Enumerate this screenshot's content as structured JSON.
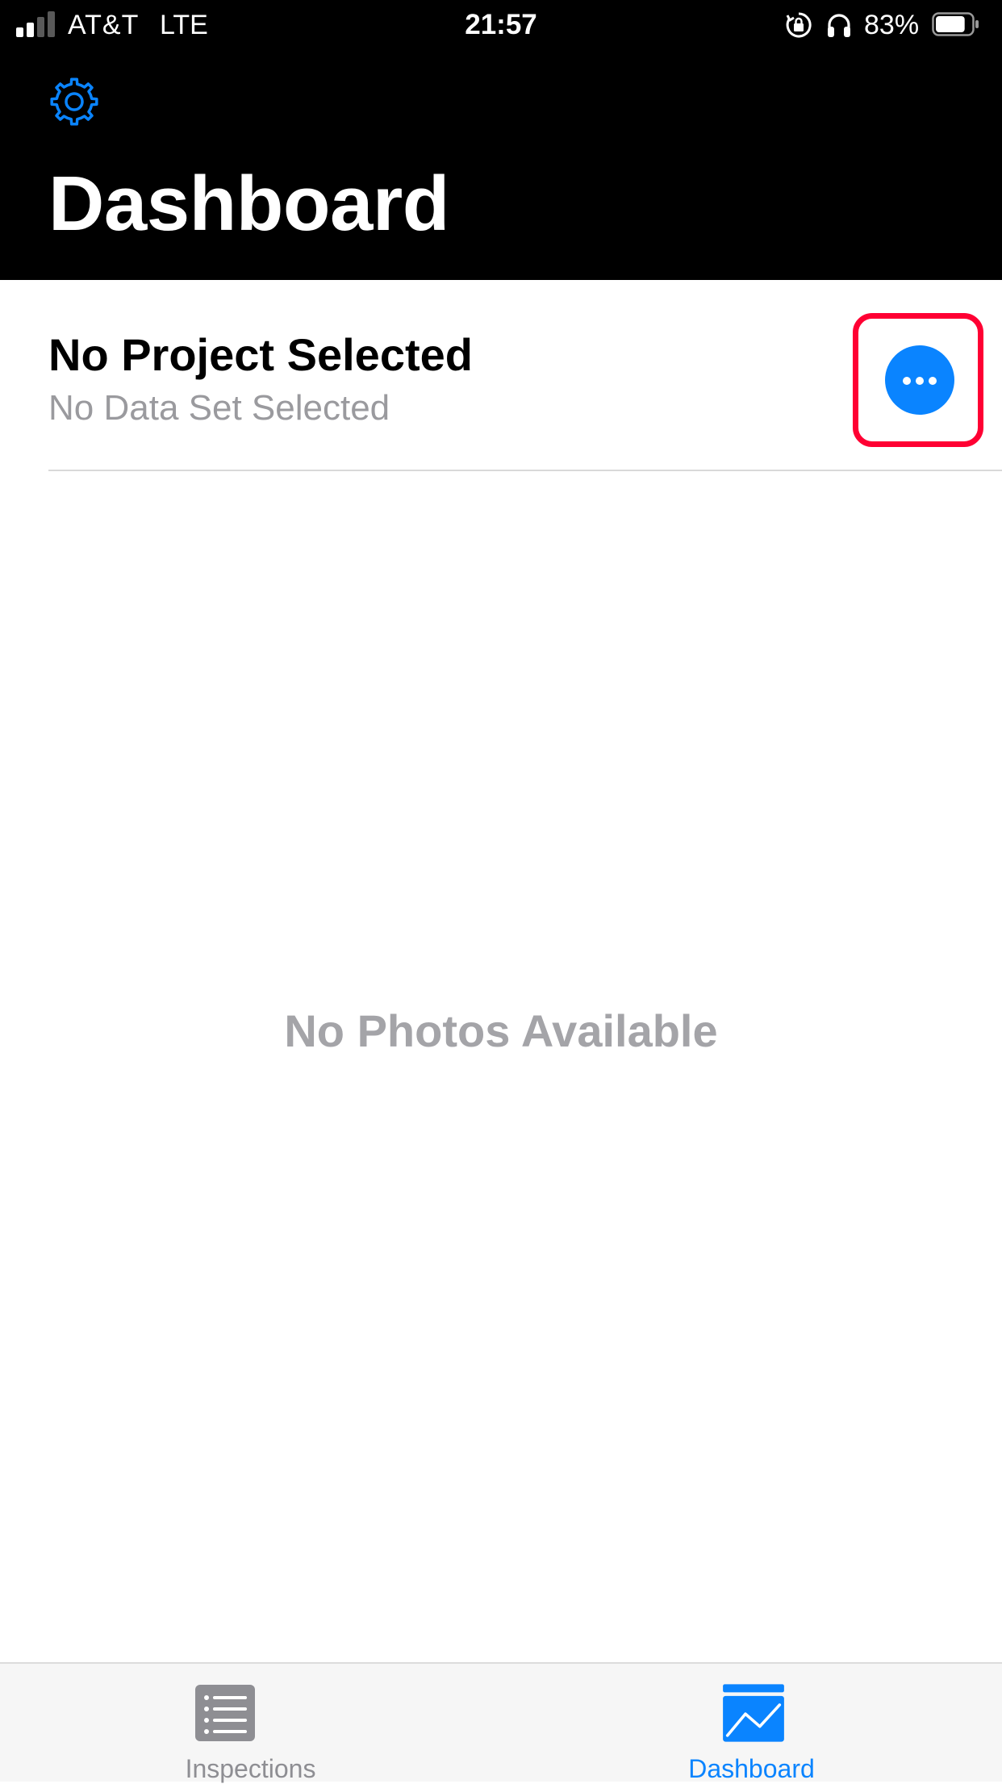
{
  "status_bar": {
    "carrier": "AT&T",
    "network": "LTE",
    "time": "21:57",
    "battery_percent": "83%",
    "battery_level": 0.83,
    "signal_bars_filled": 2,
    "signal_bars_total": 4,
    "icons": [
      "rotation-lock-icon",
      "headphones-icon",
      "battery-icon"
    ]
  },
  "header": {
    "settings_icon": "gear-icon",
    "title": "Dashboard"
  },
  "project": {
    "title": "No Project Selected",
    "subtitle": "No Data Set Selected",
    "more_icon": "ellipsis-icon"
  },
  "main": {
    "empty_message": "No Photos Available"
  },
  "tab_bar": {
    "tabs": [
      {
        "label": "Inspections",
        "icon": "list-icon",
        "selected": false
      },
      {
        "label": "Dashboard",
        "icon": "chart-icon",
        "selected": true
      }
    ]
  },
  "colors": {
    "accent": "#0a84ff",
    "header_bg": "#000000",
    "highlight": "#ff0033",
    "secondary_text": "#9a9a9e",
    "inactive_tab": "#8e8e93"
  }
}
